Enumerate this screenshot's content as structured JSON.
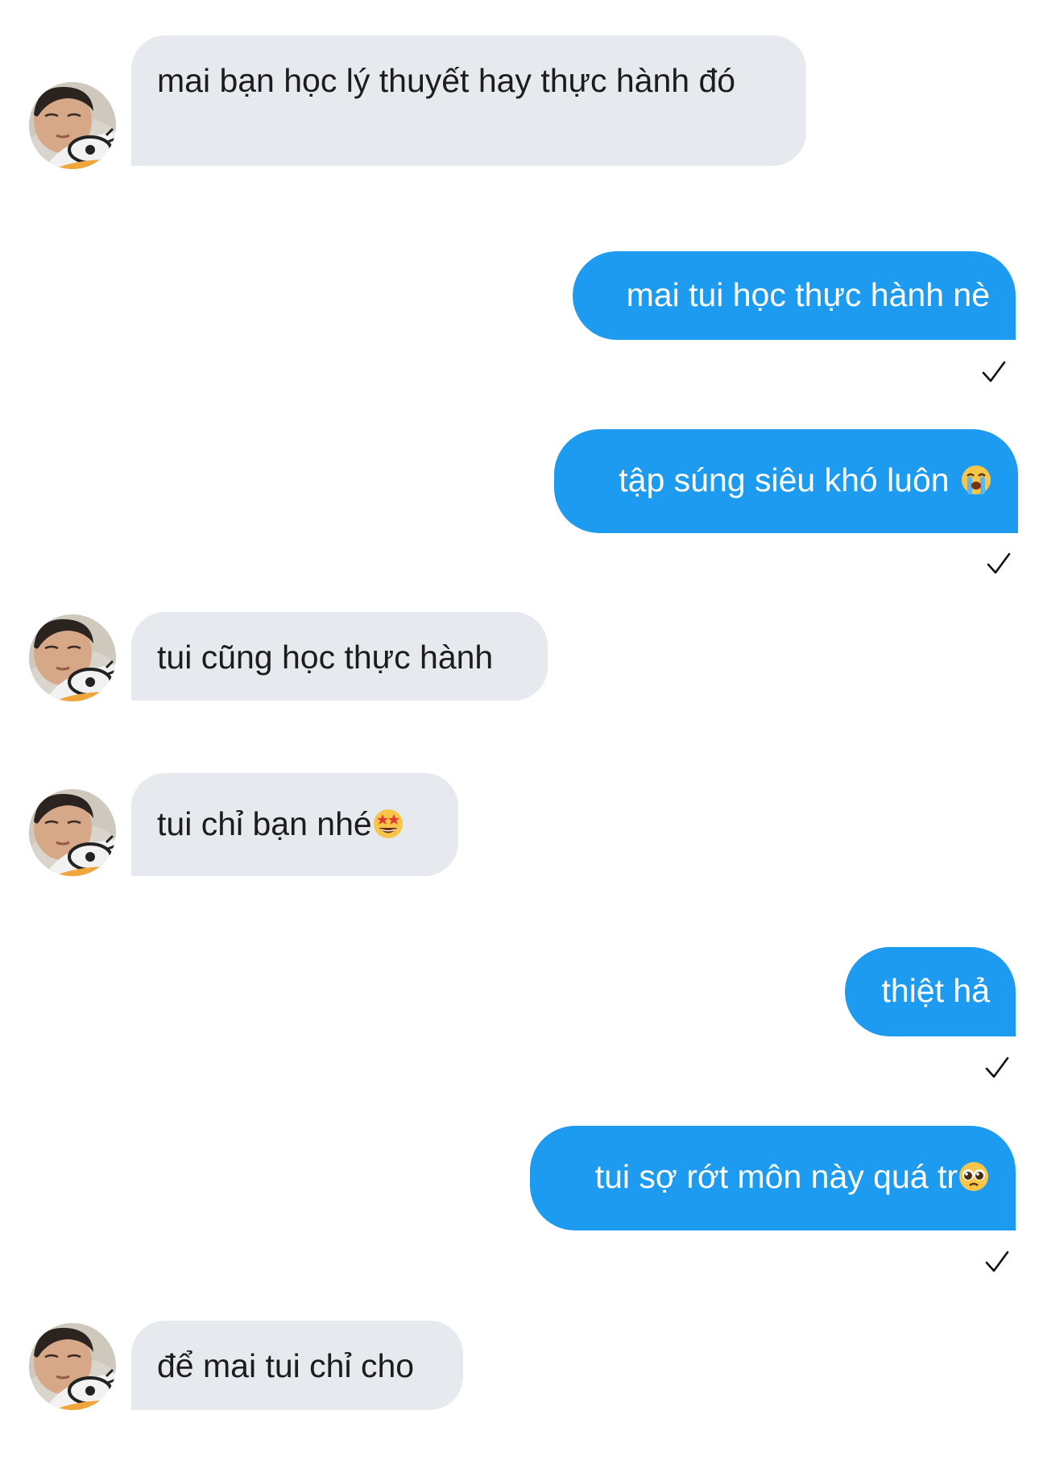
{
  "messages": [
    {
      "side": "in",
      "text": "mai bạn học lý thuyết hay thực hành đó"
    },
    {
      "side": "out",
      "text": "mai tui học thực hành nè",
      "status": "sent-check-icon"
    },
    {
      "side": "out",
      "text": "tập súng siêu khó luôn",
      "emoji": "loudly-crying-face-emoji",
      "status": "sent-check-icon"
    },
    {
      "side": "in",
      "text": "tui cũng học thực hành"
    },
    {
      "side": "in",
      "text": "tui chỉ bạn nhé",
      "emoji": "star-struck-face-emoji"
    },
    {
      "side": "out",
      "text": "thiệt hả",
      "status": "sent-check-icon"
    },
    {
      "side": "out",
      "text": "tui sợ rớt môn này quá tr",
      "emoji": "pleading-face-emoji",
      "status": "sent-check-icon"
    },
    {
      "side": "in",
      "text": "để mai tui chỉ cho"
    }
  ],
  "colors": {
    "incoming_bubble": "#e6e9ee",
    "outgoing_bubble": "#1d9bf0",
    "incoming_text": "#1c1c1e",
    "outgoing_text": "#ffffff",
    "background": "#ffffff"
  }
}
